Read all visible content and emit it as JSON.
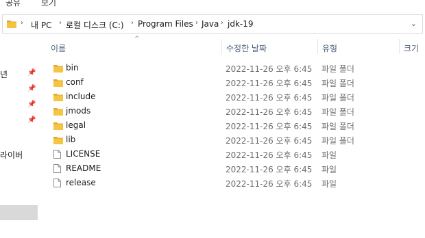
{
  "ribbon": {
    "tabs": [
      {
        "label": "공유"
      },
      {
        "label": "보기"
      }
    ]
  },
  "address_bar": {
    "crumbs": [
      "내 PC",
      "로컬 디스크 (C:)",
      "Program Files",
      "Java",
      "jdk-19"
    ],
    "separator": "›"
  },
  "columns": {
    "name": "이름",
    "modified": "수정한 날짜",
    "type": "유형",
    "size": "크기"
  },
  "nav": {
    "items": [
      {
        "label": "년"
      },
      {
        "label": ""
      },
      {
        "label": ""
      },
      {
        "label": ""
      },
      {
        "label": "라이버"
      }
    ],
    "pin_glyph": "📌"
  },
  "files": [
    {
      "name": "bin",
      "date": "2022-11-26 오후 6:45",
      "type": "파일 폴더",
      "kind": "folder"
    },
    {
      "name": "conf",
      "date": "2022-11-26 오후 6:45",
      "type": "파일 폴더",
      "kind": "folder"
    },
    {
      "name": "include",
      "date": "2022-11-26 오후 6:45",
      "type": "파일 폴더",
      "kind": "folder"
    },
    {
      "name": "jmods",
      "date": "2022-11-26 오후 6:45",
      "type": "파일 폴더",
      "kind": "folder"
    },
    {
      "name": "legal",
      "date": "2022-11-26 오후 6:45",
      "type": "파일 폴더",
      "kind": "folder"
    },
    {
      "name": "lib",
      "date": "2022-11-26 오후 6:45",
      "type": "파일 폴더",
      "kind": "folder"
    },
    {
      "name": "LICENSE",
      "date": "2022-11-26 오후 6:45",
      "type": "파일",
      "kind": "file"
    },
    {
      "name": "README",
      "date": "2022-11-26 오후 6:45",
      "type": "파일",
      "kind": "file"
    },
    {
      "name": "release",
      "date": "2022-11-26 오후 6:45",
      "type": "파일",
      "kind": "file"
    }
  ],
  "colors": {
    "folder": "#f5c542",
    "folder_dark": "#e0a82e",
    "header_text": "#4c607a"
  }
}
